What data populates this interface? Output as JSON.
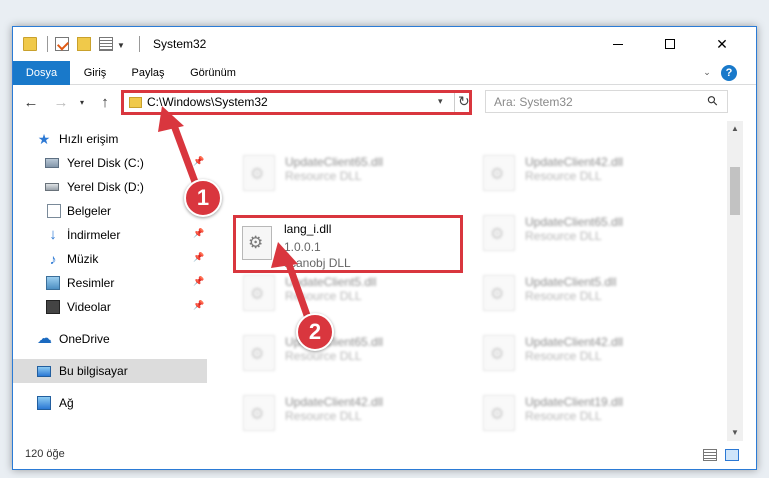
{
  "window": {
    "title": "System32",
    "controls": {
      "minimize": "—",
      "maximize": "☐",
      "close": "✕"
    }
  },
  "ribbon": {
    "tabs": [
      "Dosya",
      "Giriş",
      "Paylaş",
      "Görünüm"
    ],
    "help": "?"
  },
  "navigation": {
    "back": "←",
    "forward": "→",
    "recent": "▾",
    "up": "↑",
    "address": "C:\\Windows\\System32",
    "address_dropdown": "▾",
    "refresh": "↻",
    "search_placeholder": "Ara: System32"
  },
  "sidebar": {
    "items": [
      {
        "label": "Hızlı erişim",
        "icon": "star-icon"
      },
      {
        "label": "Yerel Disk (C:)",
        "icon": "drive-icon",
        "pinned": true
      },
      {
        "label": "Yerel Disk (D:)",
        "icon": "drive-icon",
        "pinned": true
      },
      {
        "label": "Belgeler",
        "icon": "documents-icon",
        "pinned": true
      },
      {
        "label": "İndirmeler",
        "icon": "download-icon",
        "pinned": true
      },
      {
        "label": "Müzik",
        "icon": "music-icon",
        "pinned": true
      },
      {
        "label": "Resimler",
        "icon": "pictures-icon",
        "pinned": true
      },
      {
        "label": "Videolar",
        "icon": "videos-icon",
        "pinned": true
      },
      {
        "label": "OneDrive",
        "icon": "cloud-icon"
      },
      {
        "label": "Bu bilgisayar",
        "icon": "computer-icon",
        "selected": true
      },
      {
        "label": "Ağ",
        "icon": "network-icon"
      }
    ]
  },
  "files": {
    "left_column": [
      {
        "name": "UpdateClient65.dll",
        "type": "Resource DLL"
      },
      {
        "name": "UpdateClient5.dll",
        "type": "Resource DLL"
      },
      {
        "name": "UpdateClient65.dll",
        "type": "Resource DLL"
      },
      {
        "name": "UpdateClient42.dll",
        "type": "Resource DLL"
      }
    ],
    "right_column": [
      {
        "name": "UpdateClient42.dll",
        "type": "Resource DLL"
      },
      {
        "name": "UpdateClient65.dll",
        "type": "Resource DLL"
      },
      {
        "name": "UpdateClient5.dll",
        "type": "Resource DLL"
      },
      {
        "name": "UpdateClient42.dll",
        "type": "Resource DLL"
      },
      {
        "name": "UpdateClient19.dll",
        "type": "Resource DLL"
      }
    ],
    "highlighted": {
      "name": "lang_i.dll",
      "version": "1.0.0.1",
      "type": "scanobj DLL"
    }
  },
  "status": {
    "item_count": "120 öğe"
  },
  "callouts": {
    "step1": "1",
    "step2": "2"
  },
  "colors": {
    "accent": "#1979ca",
    "highlight": "#d9363e"
  }
}
